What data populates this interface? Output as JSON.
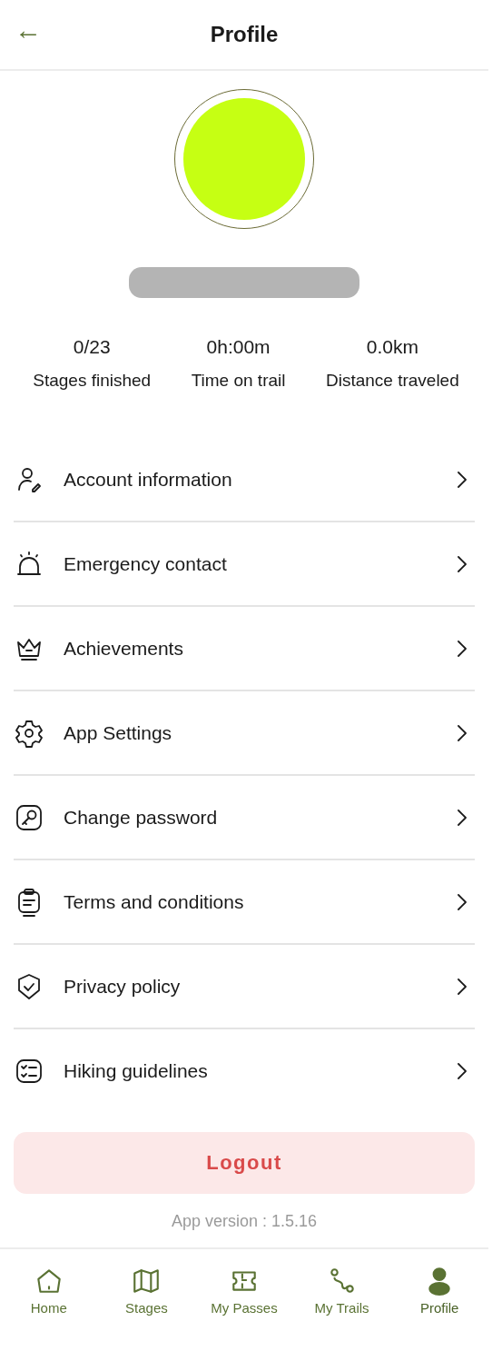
{
  "header": {
    "title": "Profile",
    "back_icon": "←"
  },
  "profile": {
    "avatar": {
      "color": "#c6ff13"
    },
    "name_redacted": true
  },
  "stats": [
    {
      "value": "0/23",
      "label": "Stages finished"
    },
    {
      "value": "0h:00m",
      "label": "Time on trail"
    },
    {
      "value": "0.0km",
      "label": "Distance traveled"
    }
  ],
  "menu": [
    {
      "kind": "account",
      "label": "Account information"
    },
    {
      "kind": "emergency",
      "label": "Emergency contact"
    },
    {
      "kind": "achievements",
      "label": "Achievements"
    },
    {
      "kind": "settings",
      "label": "App Settings"
    },
    {
      "kind": "password",
      "label": "Change password"
    },
    {
      "kind": "terms",
      "label": "Terms and conditions"
    },
    {
      "kind": "privacy",
      "label": "Privacy policy"
    },
    {
      "kind": "guidelines",
      "label": "Hiking guidelines"
    }
  ],
  "logout_button": "Logout",
  "app_version": "App version : 1.5.16",
  "bottom_nav": [
    {
      "kind": "home",
      "label": "Home",
      "selected": false
    },
    {
      "kind": "stages",
      "label": "Stages",
      "selected": false
    },
    {
      "kind": "passes",
      "label": "My Passes",
      "selected": false
    },
    {
      "kind": "trails",
      "label": "My Trails",
      "selected": false
    },
    {
      "kind": "profile",
      "label": "Profile",
      "selected": true
    }
  ]
}
